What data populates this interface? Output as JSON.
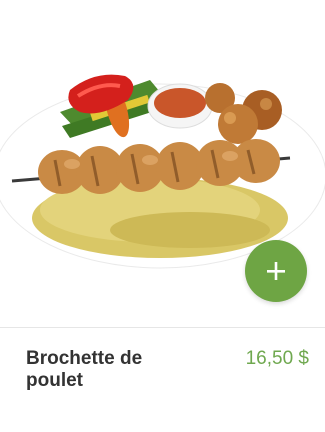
{
  "product": {
    "name": "Brochette de poulet",
    "price": "16,50 $"
  },
  "add_button": {
    "icon": "plus-icon"
  },
  "colors": {
    "accent": "#6ea544",
    "price_text": "#6fa84f",
    "name_text": "#333333"
  }
}
